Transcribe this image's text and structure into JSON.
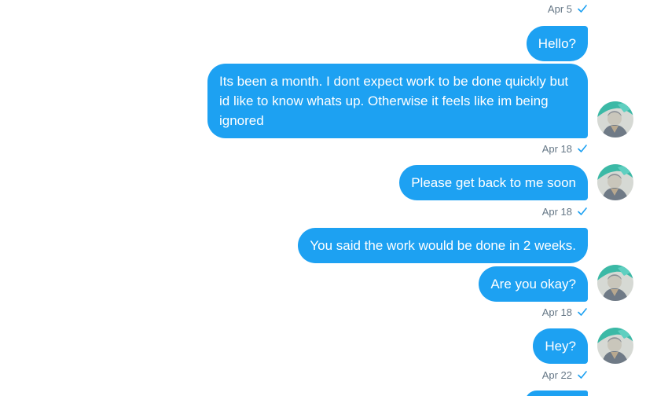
{
  "conversation": {
    "accent_color": "#1da1f2",
    "check_icon": "check-icon",
    "avatar_icon": "user-avatar",
    "stamps": [
      "Apr 5",
      "Apr 18",
      "Apr 18",
      "Apr 18",
      "Apr 22"
    ],
    "messages": [
      "Hello?",
      "Its been a month. I dont expect work to be done quickly but id like to know whats up. Otherwise it feels like im being ignored",
      "Please get back to me soon",
      "You said the work would be done in 2 weeks.",
      "Are you okay?",
      "Hey?"
    ]
  }
}
